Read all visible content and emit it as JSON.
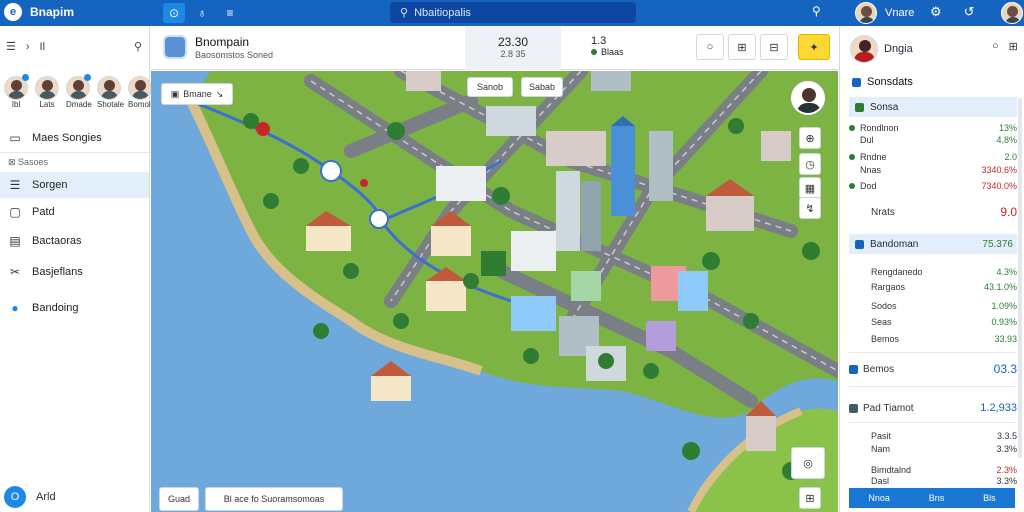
{
  "app": {
    "name": "Bnapim",
    "logo_glyph": "e"
  },
  "topbar": {
    "search_placeholder": "Nbaitiopalis",
    "user_name": "Vnare"
  },
  "sidebar": {
    "tool_label": "Il",
    "contacts": [
      "Ibl",
      "Lats",
      "Dmade",
      "Shotale",
      "Bomole"
    ],
    "items": [
      {
        "label": "Maes Songies",
        "icon": "chat-icon"
      },
      {
        "label": "Sorgen",
        "icon": "list-icon",
        "active": true
      },
      {
        "label": "Patd",
        "icon": "file-icon"
      },
      {
        "label": "Bactaoras",
        "icon": "clipboard-icon"
      },
      {
        "label": "Basjeflans",
        "icon": "tools-icon"
      },
      {
        "label": "Bandoing",
        "icon": "refresh-icon"
      }
    ],
    "sub_label": "Sasoes",
    "bottom_label": "Arld",
    "bottom_glyph": "O"
  },
  "map_header": {
    "title": "Bnompain",
    "subtitle": "Baosomstos Soned",
    "stat1_value": "23.30",
    "stat1_sub": "2.8 35",
    "stat2_value": "1.3",
    "stat2_sub": "Blaas"
  },
  "map": {
    "top_chip": "Bmane",
    "chip_a": "Sanob",
    "chip_b": "Sabab",
    "bottom_chip_a": "Guad",
    "bottom_chip_b": "Bl ace fo Suoramsomoas"
  },
  "rpanel": {
    "user_name": "Dngia",
    "section_title": "Sonsdats",
    "highlight1": "Sonsa",
    "rows1": [
      {
        "label": "Rondlnon",
        "value": "13%",
        "color": "green",
        "dot": true
      },
      {
        "label": "Dul",
        "value": "4,8%",
        "color": "green"
      },
      {
        "label": "Rndne",
        "value": "2.0",
        "color": "green",
        "dot": true
      },
      {
        "label": "Nnas",
        "value": "3340.6%",
        "color": "red"
      },
      {
        "label": "Dod",
        "value": "7340.0%",
        "color": "red",
        "dot": true
      }
    ],
    "single_label": "Nrats",
    "single_value": "9.0",
    "highlight2_label": "Bandoman",
    "highlight2_value": "75.376",
    "rows2": [
      {
        "label": "Rengdanedo",
        "value": "4.3%",
        "color": "green"
      },
      {
        "label": "Rargaos",
        "value": "43.1.0%",
        "color": "green"
      },
      {
        "label": "Sodos",
        "value": "1.09%",
        "color": "green"
      },
      {
        "label": "Seas",
        "value": "0.93%",
        "color": "green"
      },
      {
        "label": "Bemos",
        "value": "33.93",
        "color": "green"
      }
    ],
    "section3_label": "Bemos",
    "section3_value": "03.3",
    "section4_label": "Pad Tiamot",
    "section4_value": "1.2,933",
    "rows4": [
      {
        "label": "Pasit",
        "value": "3.3.5",
        "color": "plain"
      },
      {
        "label": "Nam",
        "value": "3.3%",
        "color": "plain"
      },
      {
        "label": "Bimdtalnd",
        "value": "2.3%",
        "color": "red"
      },
      {
        "label": "Dasl",
        "value": "3.3%",
        "color": "plain"
      }
    ],
    "footer": [
      "Nnoa",
      "Bns",
      "Bls"
    ]
  },
  "colors": {
    "topbar": "#1565c0",
    "water": "#6fa9dc",
    "land": "#7cb342",
    "accent": "#1976d2",
    "positive": "#2e7d32",
    "negative": "#c62828"
  }
}
